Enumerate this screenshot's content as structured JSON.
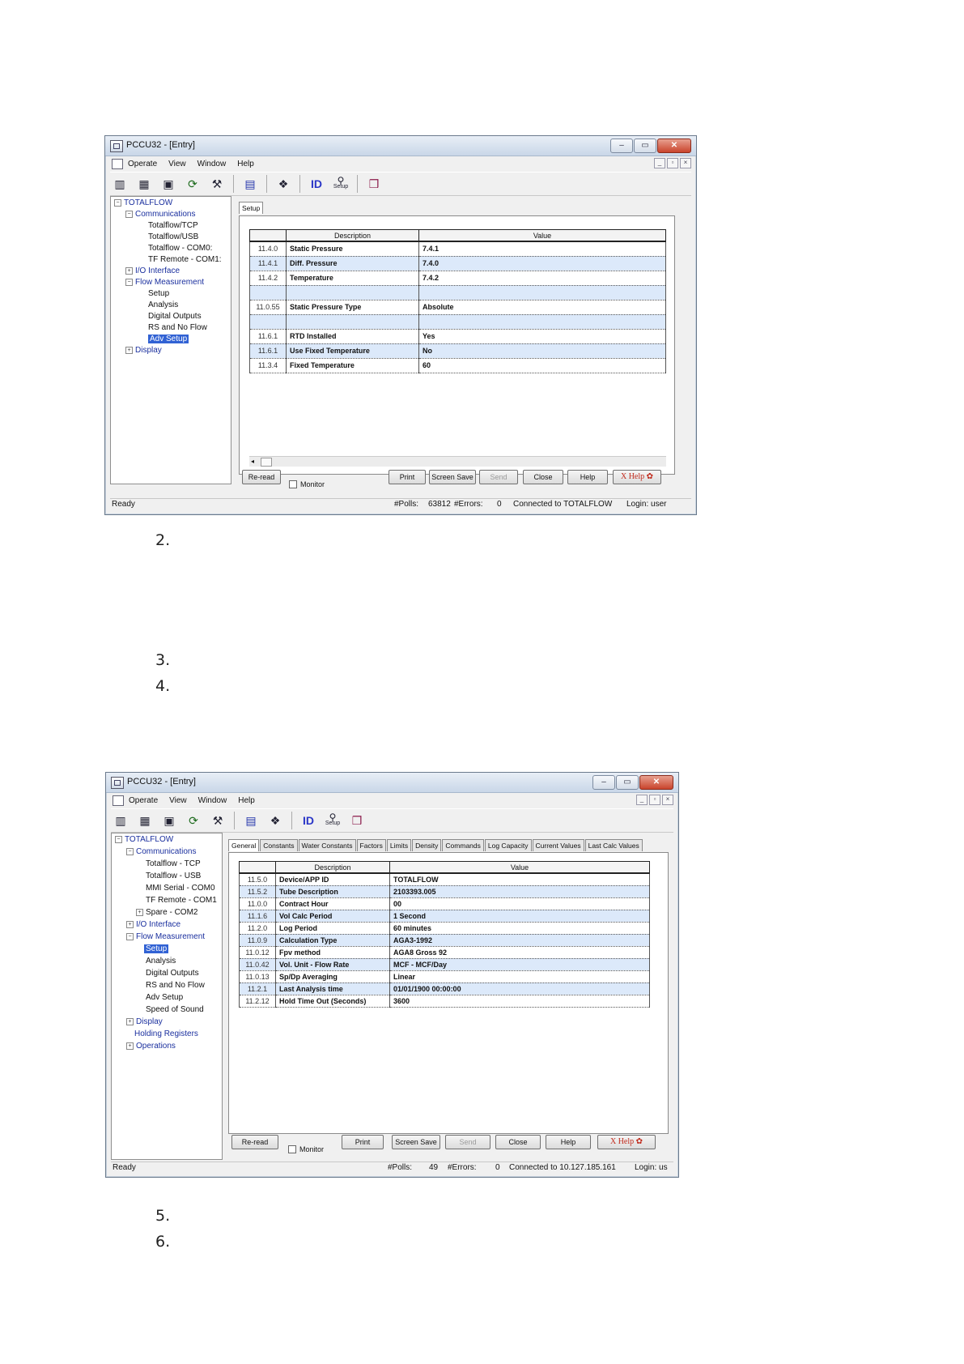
{
  "list_numbers": [
    "2.",
    "3.",
    "4.",
    "5.",
    "6."
  ],
  "window1": {
    "title": "PCCU32 - [Entry]",
    "menu": [
      "Operate",
      "View",
      "Window",
      "Help"
    ],
    "toolbar_setup_label": "Setup",
    "tree": {
      "root": "TOTALFLOW",
      "communications": "Communications",
      "comm_items": [
        "Totalflow/TCP",
        "Totalflow/USB",
        "Totalflow - COM0:",
        "TF Remote - COM1:"
      ],
      "io": "I/O Interface",
      "flow": "Flow Measurement",
      "flow_items": [
        "Setup",
        "Analysis",
        "Digital Outputs",
        "RS and No Flow"
      ],
      "selected": "Adv Setup",
      "display": "Display"
    },
    "tab": "Setup",
    "table": {
      "headers": [
        "Description",
        "Value"
      ],
      "rows": [
        {
          "idx": "11.4.0",
          "desc": "Static Pressure",
          "val": "7.4.1"
        },
        {
          "idx": "11.4.1",
          "desc": "Diff. Pressure",
          "val": "7.4.0"
        },
        {
          "idx": "11.4.2",
          "desc": "Temperature",
          "val": "7.4.2"
        },
        {
          "idx": "",
          "desc": "",
          "val": ""
        },
        {
          "idx": "11.0.55",
          "desc": "Static Pressure Type",
          "val": "Absolute"
        },
        {
          "idx": "",
          "desc": "",
          "val": ""
        },
        {
          "idx": "11.6.1",
          "desc": "RTD Installed",
          "val": "Yes"
        },
        {
          "idx": "11.6.1",
          "desc": "Use Fixed Temperature",
          "val": "No"
        },
        {
          "idx": "11.3.4",
          "desc": "Fixed Temperature",
          "val": "60"
        }
      ]
    },
    "buttons": {
      "reread": "Re-read",
      "monitor": "Monitor",
      "print": "Print",
      "screen_save": "Screen Save",
      "send": "Send",
      "close": "Close",
      "help": "Help",
      "xhelp": "X Help"
    },
    "status": {
      "ready": "Ready",
      "polls_label": "#Polls:",
      "polls": "63812",
      "errors_label": "#Errors:",
      "errors": "0",
      "connection": "Connected to TOTALFLOW",
      "login": "Login: user"
    }
  },
  "window2": {
    "title": "PCCU32 - [Entry]",
    "menu": [
      "Operate",
      "View",
      "Window",
      "Help"
    ],
    "toolbar_setup_label": "Setup",
    "tree": {
      "root": "TOTALFLOW",
      "communications": "Communications",
      "comm_items": [
        "Totalflow - TCP",
        "Totalflow - USB",
        "MMI Serial - COM0",
        "TF Remote - COM1",
        "Spare - COM2"
      ],
      "io": "I/O Interface",
      "flow": "Flow Measurement",
      "selected": "Setup",
      "flow_items": [
        "Analysis",
        "Digital Outputs",
        "RS and No Flow",
        "Adv Setup",
        "Speed of Sound"
      ],
      "display": "Display",
      "holding": "Holding Registers",
      "operations": "Operations"
    },
    "tabs": [
      "General",
      "Constants",
      "Water Constants",
      "Factors",
      "Limits",
      "Density",
      "Commands",
      "Log Capacity",
      "Current Values",
      "Last Calc Values"
    ],
    "table": {
      "headers": [
        "Description",
        "Value"
      ],
      "rows": [
        {
          "idx": "11.5.0",
          "desc": "Device/APP ID",
          "val": "TOTALFLOW"
        },
        {
          "idx": "11.5.2",
          "desc": "Tube Description",
          "val": "2103393.005"
        },
        {
          "idx": "11.0.0",
          "desc": "Contract Hour",
          "val": "00"
        },
        {
          "idx": "11.1.6",
          "desc": "Vol Calc Period",
          "val": "1 Second"
        },
        {
          "idx": "11.2.0",
          "desc": "Log Period",
          "val": "60 minutes"
        },
        {
          "idx": "11.0.9",
          "desc": "Calculation Type",
          "val": "AGA3-1992"
        },
        {
          "idx": "11.0.12",
          "desc": "Fpv method",
          "val": "AGA8 Gross 92"
        },
        {
          "idx": "11.0.42",
          "desc": "Vol. Unit - Flow Rate",
          "val": "MCF - MCF/Day"
        },
        {
          "idx": "11.0.13",
          "desc": "Sp/Dp Averaging",
          "val": "Linear"
        },
        {
          "idx": "11.2.1",
          "desc": "Last Analysis time",
          "val": "01/01/1900 00:00:00"
        },
        {
          "idx": "11.2.12",
          "desc": "Hold Time Out (Seconds)",
          "val": "3600"
        }
      ]
    },
    "buttons": {
      "reread": "Re-read",
      "monitor": "Monitor",
      "print": "Print",
      "screen_save": "Screen Save",
      "send": "Send",
      "close": "Close",
      "help": "Help",
      "xhelp": "X Help"
    },
    "status": {
      "ready": "Ready",
      "polls_label": "#Polls:",
      "polls": "49",
      "errors_label": "#Errors:",
      "errors": "0",
      "connection": "Connected to 10.127.185.161",
      "login": "Login: us"
    }
  }
}
